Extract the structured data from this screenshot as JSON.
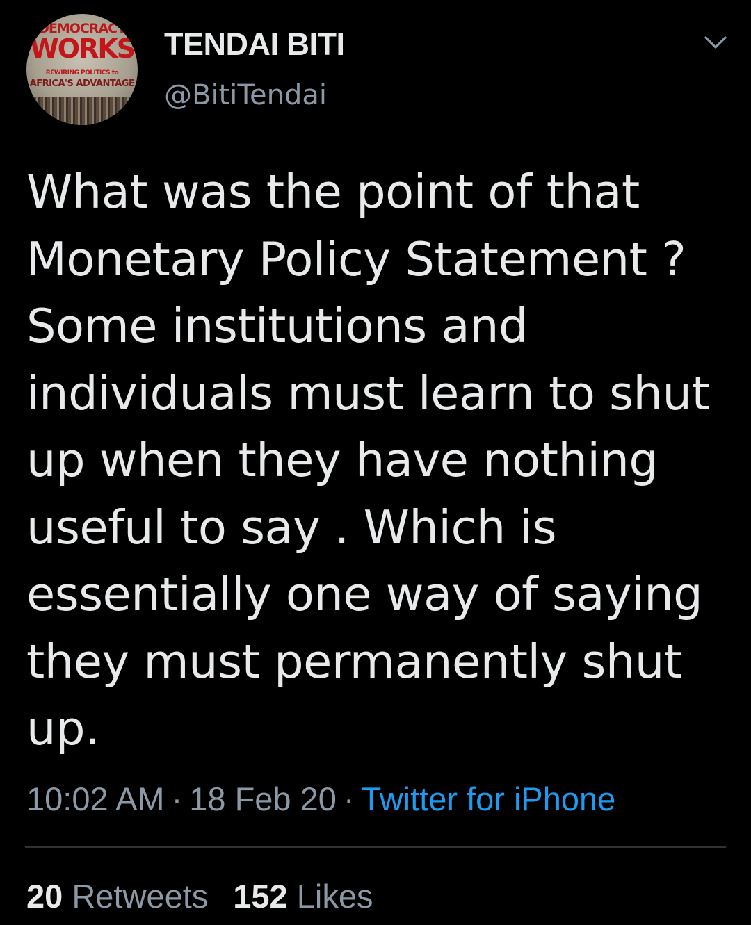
{
  "author": {
    "name": "TENDAI BITI",
    "handle": "@BitiTendai",
    "avatar": {
      "book_title_top": "DEMOCRACY",
      "book_title_big": "WORKS",
      "book_subtitle_1": "REWIRING POLITICS to",
      "book_subtitle_2": "AFRICA'S ADVANTAGE"
    }
  },
  "menu": {
    "icon": "chevron-down-icon"
  },
  "tweet": {
    "text": "What was the point of that\nMonetary Policy Statement ?\nSome institutions and\nindividuals must learn to shut\nup when they have nothing\nuseful to say . Which is\nessentially one way of saying\nthey must permanently shut\nup."
  },
  "meta": {
    "time": "10:02 AM",
    "date": "18 Feb 20",
    "separator": "·",
    "source": "Twitter for iPhone"
  },
  "stats": {
    "retweets_count": "20",
    "retweets_label": "Retweets",
    "likes_count": "152",
    "likes_label": "Likes"
  },
  "colors": {
    "background": "#000000",
    "text": "#e7e9ea",
    "secondary": "#8b98a5",
    "link": "#1d9bf0",
    "divider": "#2f3336"
  }
}
